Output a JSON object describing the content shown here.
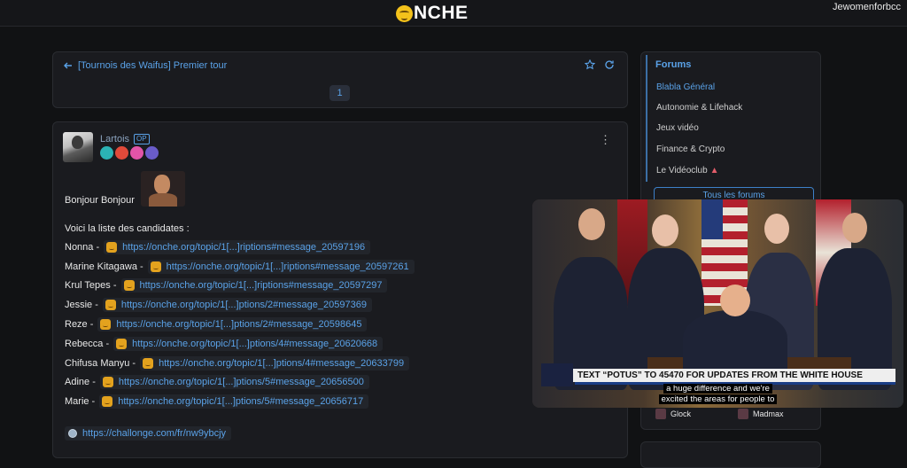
{
  "header": {
    "logo_text": "NCHE",
    "username": "Jewomenforbcc"
  },
  "topic": {
    "back_icon": "arrow-left-icon",
    "title": "[Tournois des Waifus] Premier tour",
    "star_icon": "star-icon",
    "refresh_icon": "refresh-icon",
    "page": "1"
  },
  "post": {
    "author": "Lartois",
    "op_badge": "OP",
    "badge_colors": [
      "#2bb3b5",
      "#e04a3a",
      "#e254a8",
      "#6a5cc9"
    ],
    "greeting": "Bonjour Bonjour",
    "intro": "Voici la liste des candidates :",
    "candidates": [
      {
        "name": "Nonna -",
        "link": "https://onche.org/topic/1[...]riptions#message_20597196"
      },
      {
        "name": "Marine Kitagawa -",
        "link": "https://onche.org/topic/1[...]riptions#message_20597261"
      },
      {
        "name": "Krul Tepes -",
        "link": "https://onche.org/topic/1[...]riptions#message_20597297"
      },
      {
        "name": "Jessie -",
        "link": "https://onche.org/topic/1[...]ptions/2#message_20597369"
      },
      {
        "name": "Reze -",
        "link": "https://onche.org/topic/1[...]ptions/2#message_20598645"
      },
      {
        "name": "Rebecca -",
        "link": "https://onche.org/topic/1[...]ptions/4#message_20620668"
      },
      {
        "name": "Chifusa Manyu -",
        "link": "https://onche.org/topic/1[...]ptions/4#message_20633799"
      },
      {
        "name": "Adine -",
        "link": "https://onche.org/topic/1[...]ptions/5#message_20656500"
      },
      {
        "name": "Marie -",
        "link": "https://onche.org/topic/1[...]ptions/5#message_20656717"
      }
    ],
    "external_link": "https://challonge.com/fr/nw9ybcjy"
  },
  "sidebar": {
    "title": "Forums",
    "items": [
      {
        "label": "Blabla Général",
        "active": true
      },
      {
        "label": "Autonomie & Lifehack"
      },
      {
        "label": "Jeux vidéo"
      },
      {
        "label": "Finance & Crypto"
      },
      {
        "label": "Le Vidéoclub"
      }
    ],
    "videoclub_tag_icon": "ticket-icon",
    "all_forums": "Tous les forums",
    "online": [
      {
        "name": "Glock"
      },
      {
        "name": "Madmax"
      }
    ]
  },
  "video": {
    "chyron": "TEXT “POTUS” TO 45470 FOR UPDATES FROM THE WHITE HOUSE",
    "caption_line1": "a huge difference and we're",
    "caption_line2": "excited the areas for people to"
  }
}
